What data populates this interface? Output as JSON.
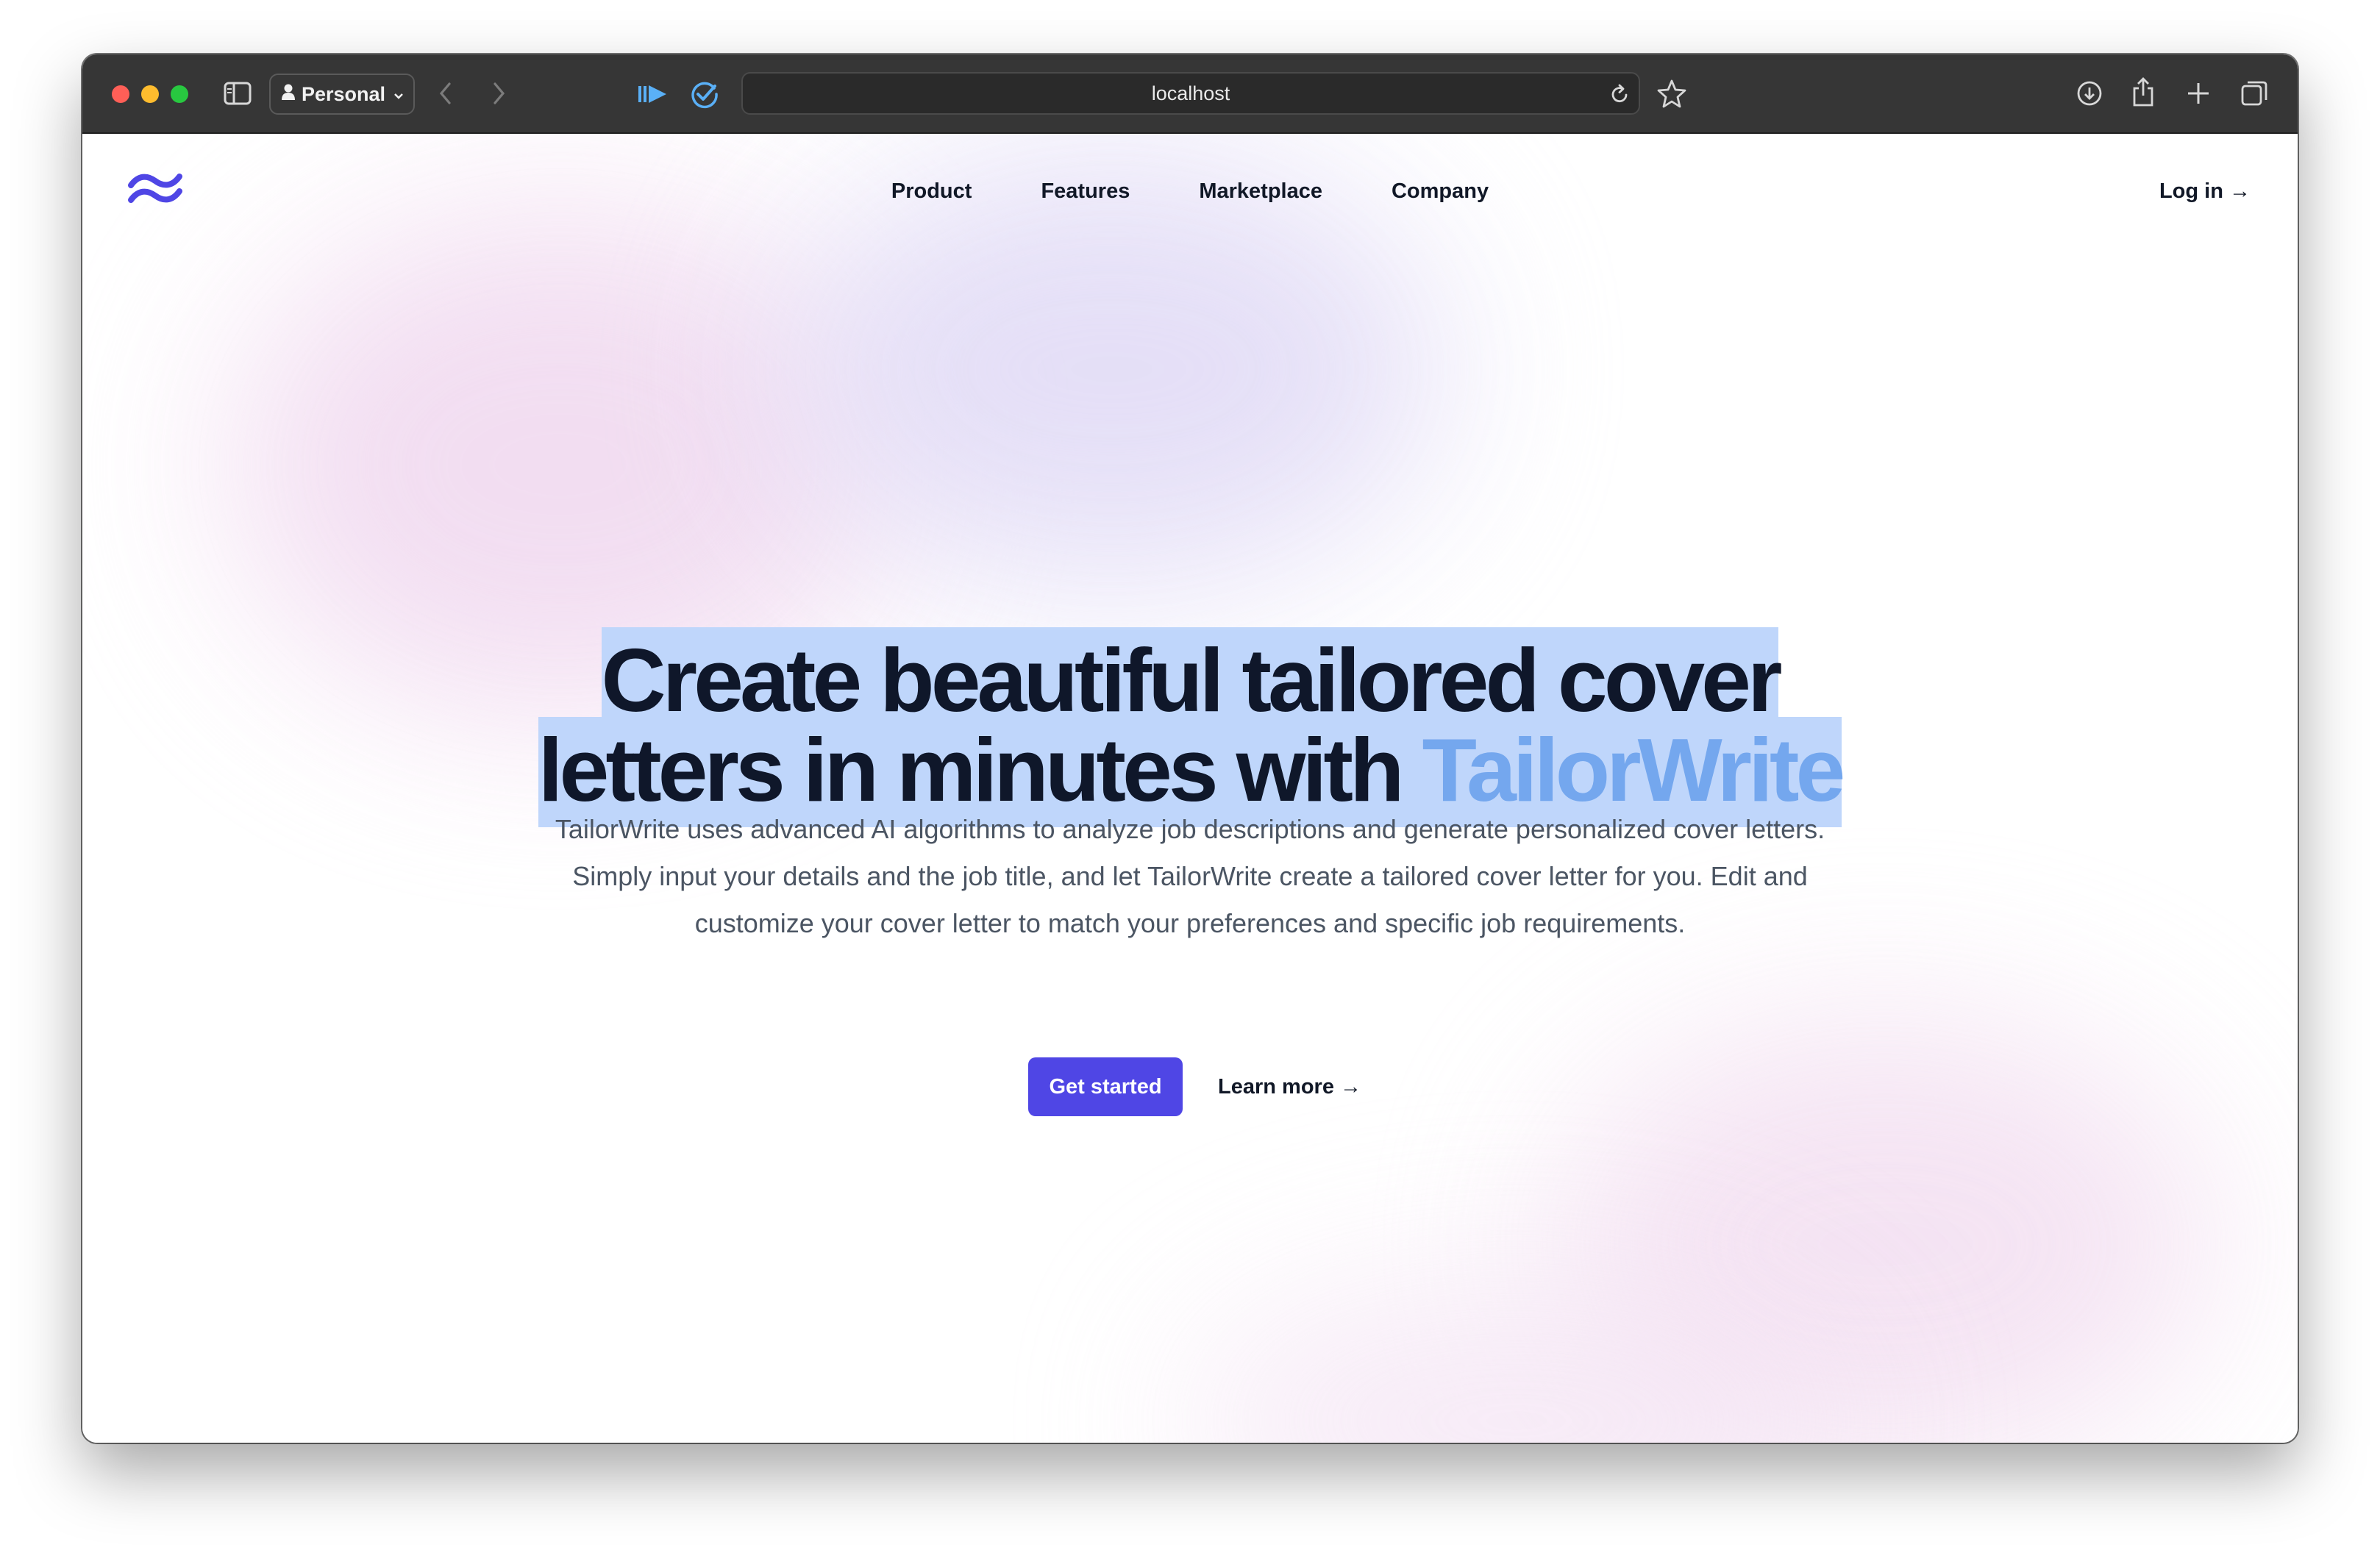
{
  "browser": {
    "profile_label": "Personal",
    "url": "localhost"
  },
  "nav": {
    "links": [
      "Product",
      "Features",
      "Marketplace",
      "Company"
    ],
    "login": "Log in →"
  },
  "hero": {
    "title_line1": "Create beautiful tailored cover",
    "title_line2_prefix": "letters in minutes with ",
    "title_line2_accent": "TailorWrite",
    "description": "TailorWrite uses advanced AI algorithms to analyze job descriptions and generate personalized cover letters. Simply input your details and the job title, and let TailorWrite create a tailored cover letter for you. Edit and customize your cover letter to match your preferences and specific job requirements.",
    "primary_button": "Get started",
    "secondary_link": "Learn more →"
  },
  "colors": {
    "brand": "#4f46e5",
    "heading": "#0f172a",
    "accent": "#74a7ee",
    "selection": "#bfd6fb",
    "toolbar": "#363636"
  },
  "icons": [
    "sidebar-toggle-icon",
    "person-icon",
    "chevron-down-icon",
    "back-arrow-icon",
    "forward-arrow-icon",
    "media-play-icon",
    "checkmark-circle-icon",
    "reload-icon",
    "star-icon",
    "download-icon",
    "share-icon",
    "new-tab-icon",
    "tab-overview-icon",
    "wave-logo"
  ]
}
